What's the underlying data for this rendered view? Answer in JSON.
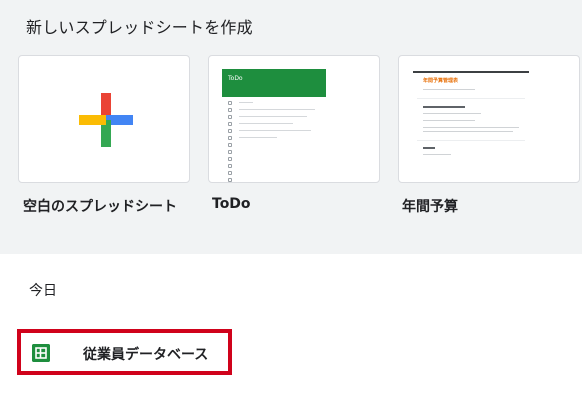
{
  "templates_section": {
    "title": "新しいスプレッドシートを作成",
    "cards": [
      {
        "label": "空白のスプレッドシート",
        "icon": "google-plus-icon"
      },
      {
        "label": "ToDo",
        "thumbnail_title": "ToDo"
      },
      {
        "label": "年間予算",
        "thumbnail_title": "年間予算管理表"
      }
    ]
  },
  "recent_section": {
    "title": "今日",
    "files": [
      {
        "name": "従業員データベース",
        "icon": "google-sheets-icon"
      }
    ]
  },
  "colors": {
    "background_top": "#f1f3f4",
    "sheets_green": "#1e8e3e",
    "plus_red": "#ea4335",
    "plus_blue": "#4285f4",
    "plus_yellow": "#fbbc04",
    "plus_green": "#34a853",
    "highlight_red": "#d0021b",
    "budget_orange": "#e8710a"
  }
}
